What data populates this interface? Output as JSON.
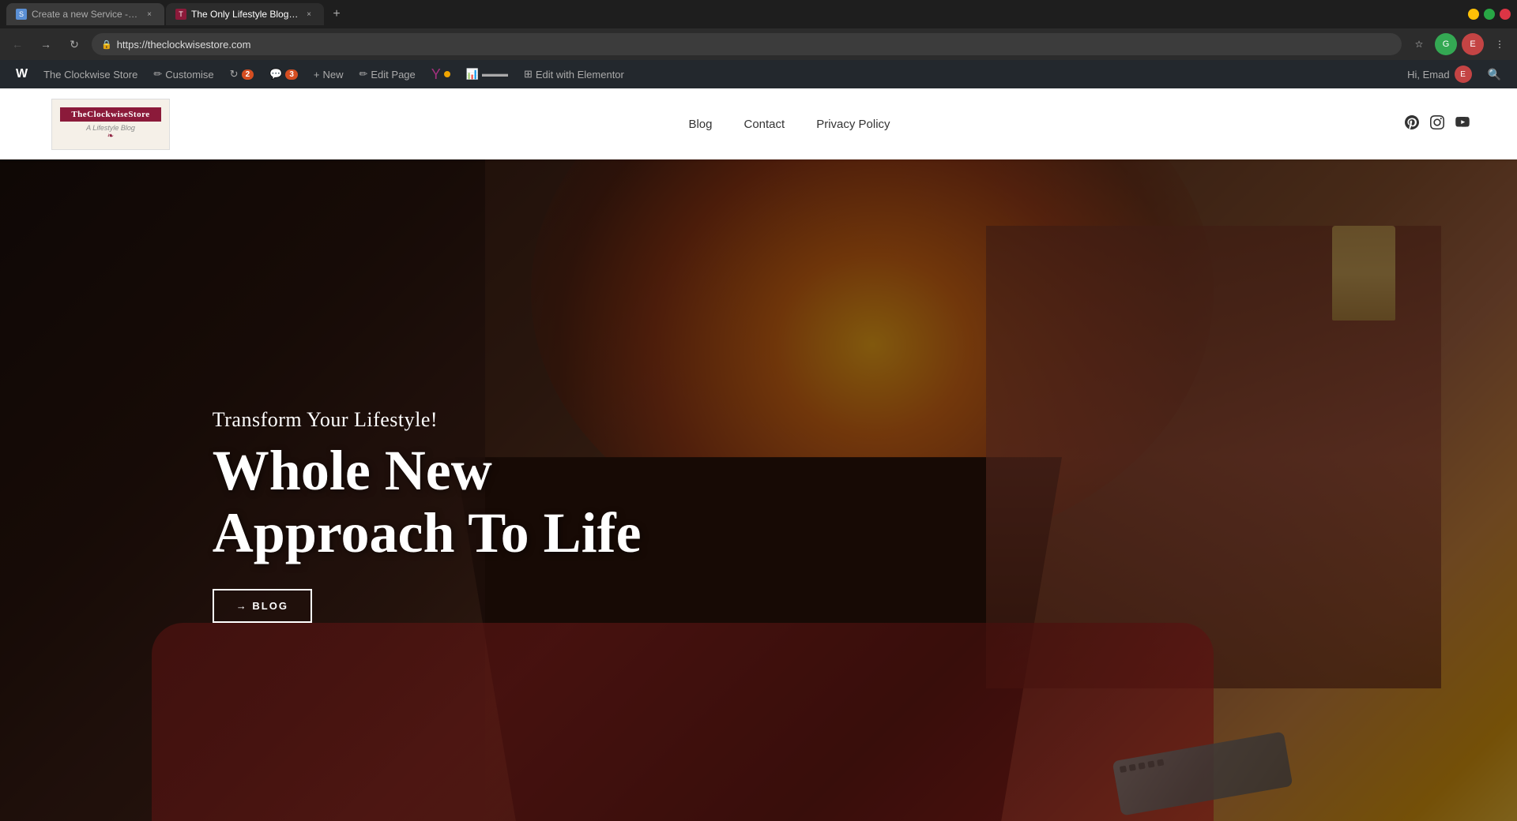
{
  "browser": {
    "tabs": [
      {
        "id": "tab1",
        "label": "Create a new Service - SEOClerks",
        "active": false,
        "favicon": "🔧"
      },
      {
        "id": "tab2",
        "label": "The Only Lifestyle Blog That Tea…",
        "active": true,
        "favicon": "📄"
      }
    ],
    "add_tab_label": "+",
    "url": "https://theclockwisestore.com",
    "nav": {
      "back_label": "←",
      "forward_label": "→",
      "refresh_label": "↻",
      "home_label": "⌂"
    },
    "window_controls": {
      "minimize": "−",
      "restore": "□",
      "close": "×"
    }
  },
  "wp_admin_bar": {
    "items": [
      {
        "id": "wp-logo",
        "label": "W",
        "icon": "wp"
      },
      {
        "id": "site-name",
        "label": "The Clockwise Store"
      },
      {
        "id": "customize",
        "label": "Customise",
        "icon": "✏"
      },
      {
        "id": "updates",
        "label": "2",
        "badge": true
      },
      {
        "id": "comments",
        "label": "3",
        "badge": true,
        "icon": "💬"
      },
      {
        "id": "new",
        "label": "New",
        "icon": "+"
      },
      {
        "id": "edit-page",
        "label": "Edit Page",
        "icon": "✏"
      },
      {
        "id": "yoast",
        "label": "●",
        "dot": true
      },
      {
        "id": "gauge",
        "label": ""
      }
    ],
    "greeting": "Hi, Emad",
    "search_label": "🔍"
  },
  "site_header": {
    "logo": {
      "brand_name": "TheClockwiseStore",
      "subtitle": "A Lifestyle Blog",
      "decoration": "❧"
    },
    "nav_links": [
      {
        "label": "Blog",
        "href": "#blog"
      },
      {
        "label": "Contact",
        "href": "#contact"
      },
      {
        "label": "Privacy Policy",
        "href": "#privacy"
      }
    ],
    "social_icons": [
      {
        "id": "pinterest",
        "label": "𝐏",
        "aria": "Pinterest"
      },
      {
        "id": "instagram",
        "label": "◻",
        "aria": "Instagram"
      },
      {
        "id": "youtube",
        "label": "▶",
        "aria": "YouTube"
      }
    ]
  },
  "hero": {
    "subtitle": "Transform Your Lifestyle!",
    "title_line1": "Whole New",
    "title_line2": "Approach To Life",
    "cta_label": "→ BLOG",
    "cta_href": "#blog"
  }
}
